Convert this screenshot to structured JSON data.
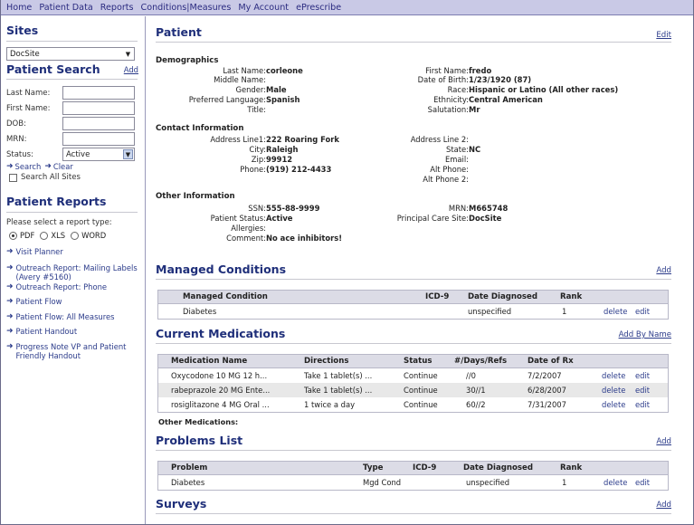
{
  "nav": {
    "items": [
      "Home",
      "Patient Data",
      "Reports",
      "Conditions|Measures",
      "My Account",
      "ePrescribe"
    ]
  },
  "sidebar": {
    "sites_title": "Sites",
    "site_select_value": "DocSite",
    "patient_search_title": "Patient Search",
    "add_link": "Add",
    "last_name_label": "Last Name:",
    "first_name_label": "First Name:",
    "dob_label": "DOB:",
    "mrn_label": "MRN:",
    "status_label": "Status:",
    "status_value": "Active",
    "search_link": "Search",
    "clear_link": "Clear",
    "search_all_sites": "Search All Sites",
    "reports_title": "Patient Reports",
    "report_type_prompt": "Please select a report type:",
    "report_types": [
      "PDF",
      "XLS",
      "WORD"
    ],
    "report_type_selected": "PDF",
    "reports": [
      "Visit Planner",
      "Outreach Report: Mailing Labels (Avery #5160)",
      "Outreach Report: Phone",
      "Patient Flow",
      "Patient Flow: All Measures",
      "Patient Handout",
      "Progress Note VP and Patient Friendly Handout"
    ]
  },
  "patient": {
    "title": "Patient",
    "edit_link": "Edit",
    "demographics_title": "Demographics",
    "last_name_label": "Last Name:",
    "last_name": "corleone",
    "middle_name_label": "Middle Name:",
    "middle_name": "",
    "gender_label": "Gender:",
    "gender": "Male",
    "pref_lang_label": "Preferred Language:",
    "pref_lang": "Spanish",
    "title_label": "Title:",
    "title_val": "",
    "first_name_label": "First Name:",
    "first_name": "fredo",
    "dob_label": "Date of Birth:",
    "dob": "1/23/1920 (87)",
    "race_label": "Race:",
    "race": "Hispanic or Latino (All other races)",
    "ethnicity_label": "Ethnicity:",
    "ethnicity": "Central American",
    "salutation_label": "Salutation:",
    "salutation": "Mr",
    "contact_title": "Contact Information",
    "addr1_label": "Address Line1:",
    "addr1": "222 Roaring Fork",
    "city_label": "City:",
    "city": "Raleigh",
    "zip_label": "Zip:",
    "zip": "99912",
    "phone_label": "Phone:",
    "phone": "(919) 212-4433",
    "addr2_label": "Address Line 2:",
    "addr2": "",
    "state_label": "State:",
    "state": "NC",
    "email_label": "Email:",
    "email": "",
    "alt_phone_label": "Alt Phone:",
    "alt_phone": "",
    "alt_phone2_label": "Alt Phone 2:",
    "alt_phone2": "",
    "other_title": "Other Information",
    "ssn_label": "SSN:",
    "ssn": "555-88-9999",
    "pstatus_label": "Patient Status:",
    "pstatus": "Active",
    "allergies_label": "Allergies:",
    "allergies": "",
    "comment_label": "Comment:",
    "comment": "No ace inhibitors!",
    "mrn_label": "MRN:",
    "mrn": "M665748",
    "pcs_label": "Principal Care Site:",
    "pcs": "DocSite"
  },
  "managed_conditions": {
    "title": "Managed Conditions",
    "add_link": "Add",
    "headers": [
      "Managed Condition",
      "ICD-9",
      "Date Diagnosed",
      "Rank"
    ],
    "rows": [
      {
        "condition": "Diabetes",
        "icd9": "",
        "date": "unspecified",
        "rank": "1",
        "delete": "delete",
        "edit": "edit"
      }
    ]
  },
  "medications": {
    "title": "Current Medications",
    "add_link": "Add By Name",
    "headers": [
      "Medication Name",
      "Directions",
      "Status",
      "#/Days/Refs",
      "Date of Rx"
    ],
    "rows": [
      {
        "name": "Oxycodone 10 MG 12 h...",
        "directions": "Take 1 tablet(s) ...",
        "status": "Continue",
        "refs": "//0",
        "date": "7/2/2007",
        "delete": "delete",
        "edit": "edit"
      },
      {
        "name": "rabeprazole 20 MG Ente...",
        "directions": "Take 1 tablet(s) ...",
        "status": "Continue",
        "refs": "30//1",
        "date": "6/28/2007",
        "delete": "delete",
        "edit": "edit"
      },
      {
        "name": "rosiglitazone 4 MG Oral ...",
        "directions": "1 twice a day",
        "status": "Continue",
        "refs": "60//2",
        "date": "7/31/2007",
        "delete": "delete",
        "edit": "edit"
      }
    ],
    "other_label": "Other Medications:"
  },
  "problems": {
    "title": "Problems List",
    "add_link": "Add",
    "headers": [
      "Problem",
      "Type",
      "ICD-9",
      "Date Diagnosed",
      "Rank"
    ],
    "rows": [
      {
        "problem": "Diabetes",
        "type": "Mgd Cond",
        "icd9": "",
        "date": "unspecified",
        "rank": "1",
        "delete": "delete",
        "edit": "edit"
      }
    ]
  },
  "surveys": {
    "title": "Surveys",
    "add_link": "Add"
  }
}
